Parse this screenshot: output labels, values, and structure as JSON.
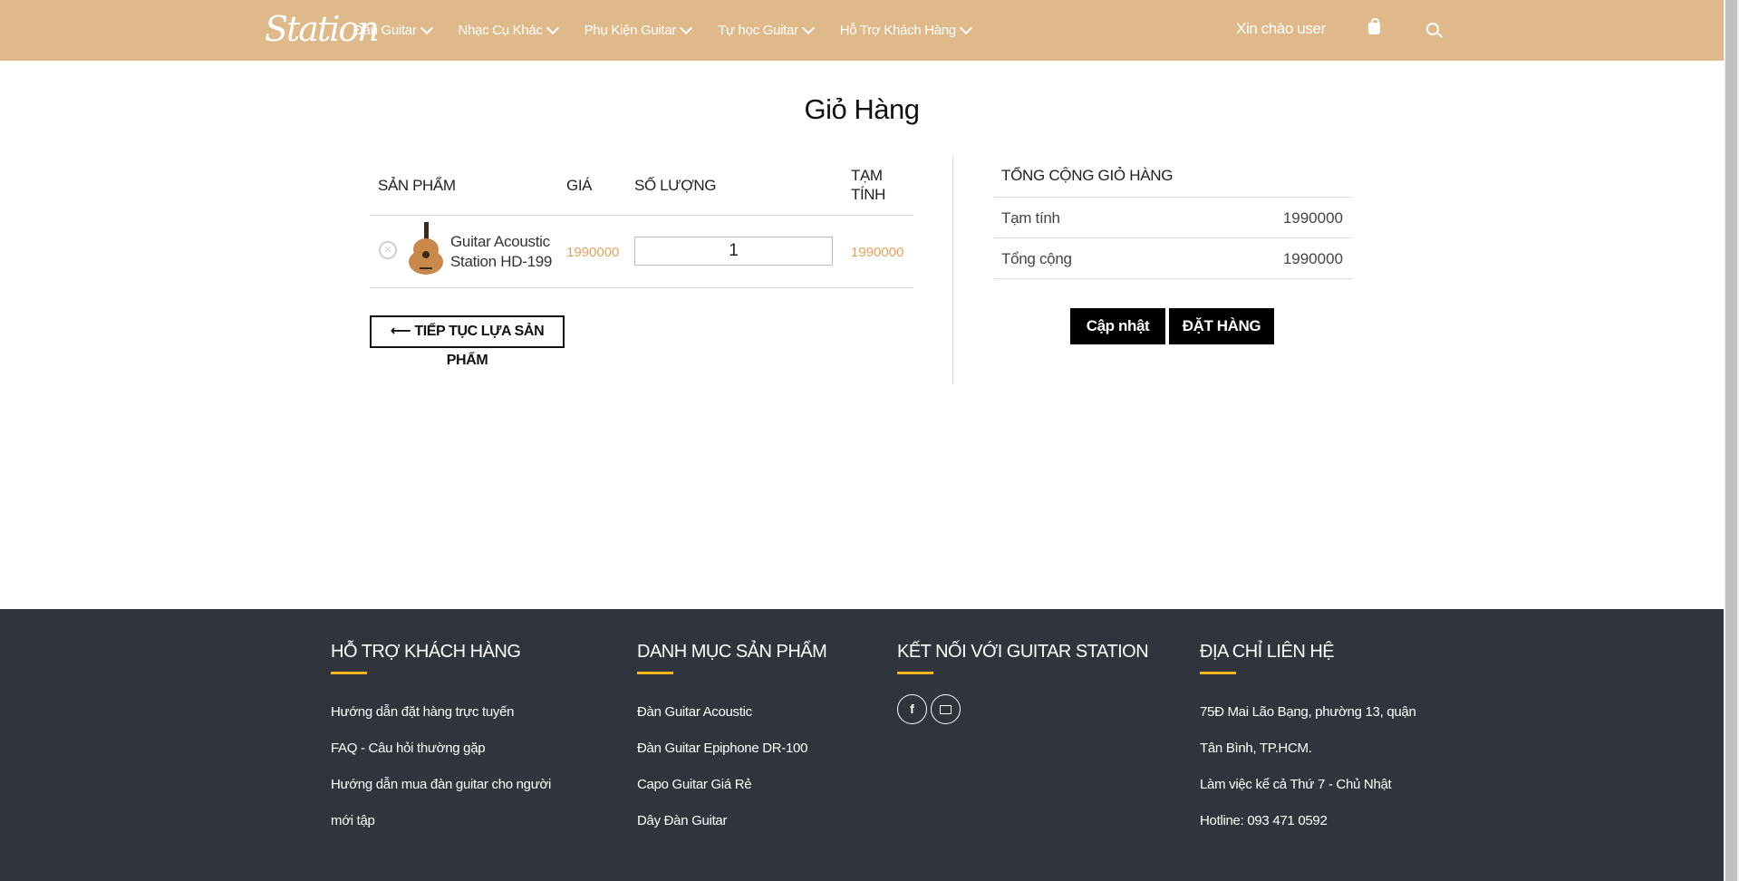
{
  "brand": {
    "logo_text": "Station"
  },
  "nav": {
    "items": [
      {
        "label": "Đàn Guitar"
      },
      {
        "label": "Nhạc Cụ Khác"
      },
      {
        "label": "Phụ Kiện Guitar"
      },
      {
        "label": "Tự học Guitar"
      },
      {
        "label": "Hỗ Trợ Khách Hàng"
      }
    ],
    "greeting": "Xin chào user",
    "icons": [
      "shopping-bag-icon",
      "search-icon"
    ]
  },
  "page": {
    "title": "Giỏ Hàng"
  },
  "cart": {
    "headers": {
      "product": "SẢN PHẨM",
      "price": "GIÁ",
      "quantity": "SỐ LƯỢNG",
      "subtotal": "TẠM TÍNH"
    },
    "items": [
      {
        "name": "Guitar Acoustic Station HD-199",
        "price": "1990000",
        "quantity": "1",
        "subtotal": "1990000"
      }
    ],
    "continue_label": "⟵ TIẾP TỤC LỰA SẢN PHẨM"
  },
  "totals": {
    "title": "TỔNG CỘNG GIỎ HÀNG",
    "rows": [
      {
        "label": "Tạm tính",
        "value": "1990000"
      },
      {
        "label": "Tổng cộng",
        "value": "1990000"
      }
    ],
    "update_label": "Cập nhật",
    "order_label": "ĐẶT HÀNG"
  },
  "footer": {
    "support": {
      "heading": "HỖ TRỢ KHÁCH HÀNG",
      "links": [
        "Hướng dẫn đặt hàng trực tuyến",
        "FAQ - Câu hỏi thường gặp",
        "Hướng dẫn mua đàn guitar cho người",
        "mới tập"
      ]
    },
    "categories": {
      "heading": "DANH MỤC SẢN PHẨM",
      "links": [
        "Đàn Guitar Acoustic",
        "Đàn Guitar Epiphone DR-100",
        "Capo Guitar Giá Rẻ",
        "Dây Đàn Guitar"
      ]
    },
    "connect": {
      "heading": "KẾT NỐI VỚI GUITAR STATION",
      "icons": [
        "facebook-icon",
        "mail-icon"
      ]
    },
    "address": {
      "heading": "ĐỊA CHỈ LIÊN HỆ",
      "lines": [
        "75Đ Mai Lão Bạng, phường 13, quận",
        "Tân Bình, TP.HCM.",
        "Làm việc kể cả Thứ 7 - Chủ Nhật",
        "Hotline: 093 471 0592"
      ]
    }
  },
  "colors": {
    "header_bg": "#dfb98a",
    "accent_price": "#e9a15a",
    "footer_bg": "#2f343d",
    "footer_bar": "#f5b51b"
  }
}
